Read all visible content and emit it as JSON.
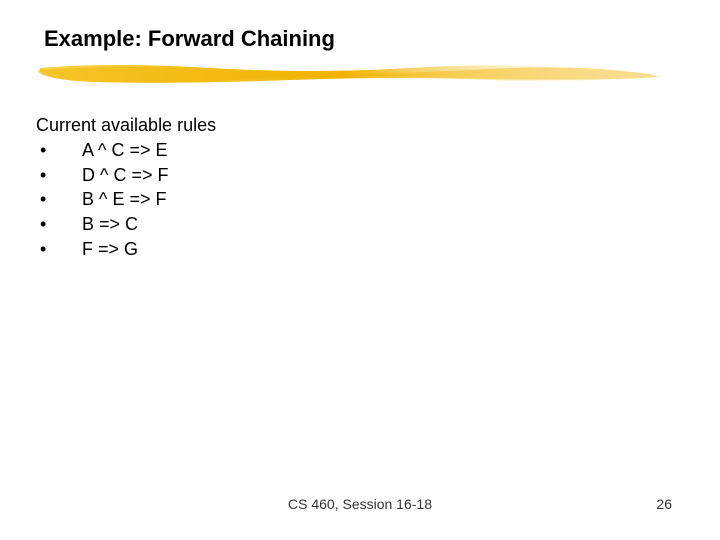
{
  "slide": {
    "title": "Example: Forward Chaining",
    "section_heading": "Current available rules",
    "bullet": "•",
    "rules": [
      "A ^ C => E",
      "D ^ C => F",
      "B ^ E => F",
      "B => C",
      "F => G"
    ],
    "footer_center": "CS 460, Session 16-18",
    "page_number": "26",
    "colors": {
      "accent": "#f2b300"
    }
  }
}
